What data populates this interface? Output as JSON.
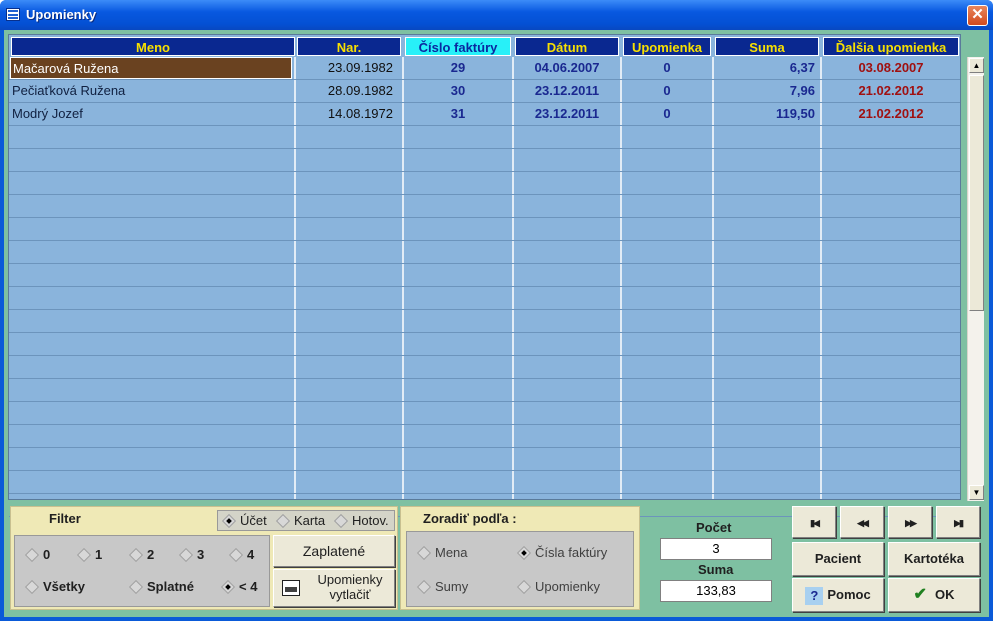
{
  "window": {
    "title": "Upomienky",
    "close_label": "✕"
  },
  "table": {
    "columns": [
      "Meno",
      "Nar.",
      "Číslo faktúry",
      "Dátum",
      "Upomienka",
      "Suma",
      "Ďalšia upomienka"
    ],
    "rows": [
      {
        "name": "Mačarová Ružena",
        "birth": "23.09.1982",
        "invoice": "29",
        "date": "04.06.2007",
        "reminder": "0",
        "sum": "6,37",
        "next": "03.08.2007"
      },
      {
        "name": "Pečiaťková Ružena",
        "birth": "28.09.1982",
        "invoice": "30",
        "date": "23.12.2011",
        "reminder": "0",
        "sum": "7,96",
        "next": "21.02.2012"
      },
      {
        "name": "Modrý Jozef",
        "birth": "14.08.1972",
        "invoice": "31",
        "date": "23.12.2011",
        "reminder": "0",
        "sum": "119,50",
        "next": "21.02.2012"
      }
    ]
  },
  "filter": {
    "title": "Filter",
    "source_options": [
      "Účet",
      "Karta",
      "Hotov."
    ],
    "level_options": [
      "0",
      "1",
      "2",
      "3",
      "4"
    ],
    "state_options": [
      "Všetky",
      "Splatné",
      "< 4"
    ],
    "paid_button": "Zaplatené",
    "print_button_line1": "Upomienky",
    "print_button_line2": "vytlačiť"
  },
  "sort": {
    "title": "Zoradiť podľa :",
    "options": [
      "Mena",
      "Čísla faktúry",
      "Sumy",
      "Upomienky"
    ]
  },
  "summary": {
    "count_label": "Počet",
    "count_value": "3",
    "sum_label": "Suma",
    "sum_value": "133,83"
  },
  "actions": {
    "patient": "Pacient",
    "cards": "Kartotéka",
    "help": "Pomoc",
    "ok": "OK"
  },
  "colors": {
    "header_bg": "#0a2890",
    "header_text": "#f8e000",
    "active_header": "#28f0f8",
    "grid_bg": "#8ab4dc",
    "selected_row": "#6a4220",
    "next_date": "#a01010"
  }
}
